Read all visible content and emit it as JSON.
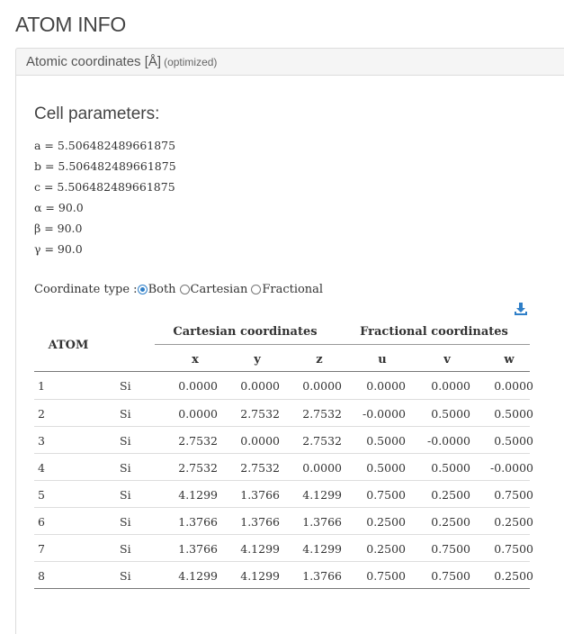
{
  "title": "ATOM INFO",
  "panel": {
    "title": "Atomic coordinates [Å]",
    "subtitle": "(optimized)"
  },
  "cell": {
    "heading": "Cell parameters:",
    "a": "a = 5.506482489661875",
    "b": "b = 5.506482489661875",
    "c": "c = 5.506482489661875",
    "alpha": "α = 90.0",
    "beta": "β = 90.0",
    "gamma": "γ = 90.0"
  },
  "coordinate_type": {
    "label": "Coordinate type :",
    "options": [
      "Both",
      "Cartesian",
      "Fractional"
    ],
    "selected": "Both"
  },
  "icons": {
    "download": "download-icon"
  },
  "table": {
    "atom_header": "ATOM",
    "cartesian_header": "Cartesian coordinates",
    "fractional_header": "Fractional coordinates",
    "columns": [
      "x",
      "y",
      "z",
      "u",
      "v",
      "w"
    ],
    "rows": [
      {
        "num": "1",
        "el": "Si",
        "x": "0.0000",
        "y": "0.0000",
        "z": "0.0000",
        "u": "0.0000",
        "v": "0.0000",
        "w": "0.0000"
      },
      {
        "num": "2",
        "el": "Si",
        "x": "0.0000",
        "y": "2.7532",
        "z": "2.7532",
        "u": "-0.0000",
        "v": "0.5000",
        "w": "0.5000"
      },
      {
        "num": "3",
        "el": "Si",
        "x": "2.7532",
        "y": "0.0000",
        "z": "2.7532",
        "u": "0.5000",
        "v": "-0.0000",
        "w": "0.5000"
      },
      {
        "num": "4",
        "el": "Si",
        "x": "2.7532",
        "y": "2.7532",
        "z": "0.0000",
        "u": "0.5000",
        "v": "0.5000",
        "w": "-0.0000"
      },
      {
        "num": "5",
        "el": "Si",
        "x": "4.1299",
        "y": "1.3766",
        "z": "4.1299",
        "u": "0.7500",
        "v": "0.2500",
        "w": "0.7500"
      },
      {
        "num": "6",
        "el": "Si",
        "x": "1.3766",
        "y": "1.3766",
        "z": "1.3766",
        "u": "0.2500",
        "v": "0.2500",
        "w": "0.2500"
      },
      {
        "num": "7",
        "el": "Si",
        "x": "1.3766",
        "y": "4.1299",
        "z": "4.1299",
        "u": "0.2500",
        "v": "0.7500",
        "w": "0.7500"
      },
      {
        "num": "8",
        "el": "Si",
        "x": "4.1299",
        "y": "4.1299",
        "z": "1.3766",
        "u": "0.7500",
        "v": "0.7500",
        "w": "0.2500"
      }
    ]
  },
  "colors": {
    "accent": "#2f7fc8"
  }
}
